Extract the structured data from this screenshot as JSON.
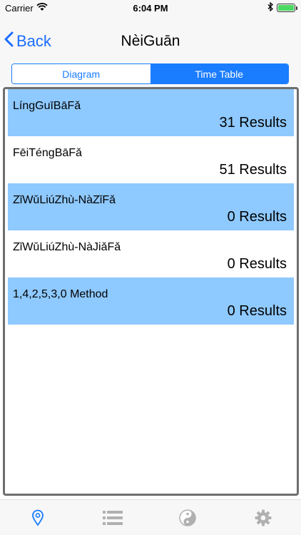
{
  "status_bar": {
    "carrier": "Carrier",
    "time": "6:04 PM"
  },
  "nav": {
    "back_label": "Back",
    "title": "NèiGuān"
  },
  "segments": [
    {
      "label": "Diagram",
      "selected": false
    },
    {
      "label": "Time Table",
      "selected": true
    }
  ],
  "rows": [
    {
      "title": "LíngGuīBāFǎ",
      "count": "31 Results"
    },
    {
      "title": "FēiTéngBāFǎ",
      "count": "51 Results"
    },
    {
      "title": "ZǐWǔLiúZhù-NàZǐFǎ",
      "count": "0 Results"
    },
    {
      "title": "ZǐWǔLiúZhù-NàJiǎFǎ",
      "count": "0 Results"
    },
    {
      "title": "1,4,2,5,3,0 Method",
      "count": "0 Results"
    }
  ],
  "tabs": [
    {
      "icon": "location-pin-icon",
      "active": true
    },
    {
      "icon": "list-icon",
      "active": false
    },
    {
      "icon": "yin-yang-icon",
      "active": false
    },
    {
      "icon": "gear-icon",
      "active": false
    }
  ],
  "colors": {
    "accent": "#1a7cff",
    "row_highlight": "#8ec9ff",
    "tab_inactive": "#b0b0b0",
    "battery": "#4cd964"
  }
}
